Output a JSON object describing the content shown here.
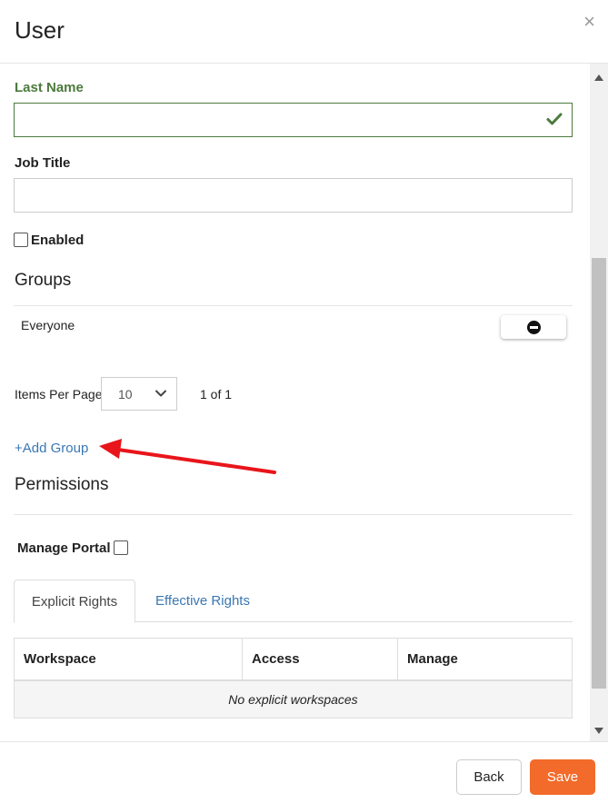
{
  "header": {
    "title": "User",
    "close": "×"
  },
  "form": {
    "last_name": {
      "label": "Last Name",
      "value": ""
    },
    "job_title": {
      "label": "Job Title",
      "value": ""
    },
    "enabled": {
      "label": "Enabled",
      "checked": false
    }
  },
  "groups": {
    "title": "Groups",
    "rows": [
      {
        "name": "Everyone"
      }
    ],
    "items_per_page_label": "Items Per Page",
    "items_per_page_value": "10",
    "pager": "1 of 1",
    "add_link": "+Add Group"
  },
  "permissions": {
    "title": "Permissions",
    "manage_portal": {
      "label": "Manage Portal",
      "checked": false
    },
    "tabs": [
      {
        "label": "Explicit Rights",
        "active": true
      },
      {
        "label": "Effective Rights",
        "active": false
      }
    ],
    "table": {
      "columns": [
        "Workspace",
        "Access",
        "Manage"
      ],
      "empty_text": "No explicit workspaces"
    }
  },
  "footer": {
    "back_label": "Back",
    "save_label": "Save"
  },
  "colors": {
    "accent": "#f26b2b",
    "link": "#3a77b3",
    "valid": "#4b7a3c",
    "annotation": "#e8151b"
  },
  "icons": [
    "close-icon",
    "check-icon",
    "minus-circle-icon",
    "chevron-down-icon",
    "arrow-annotation"
  ]
}
